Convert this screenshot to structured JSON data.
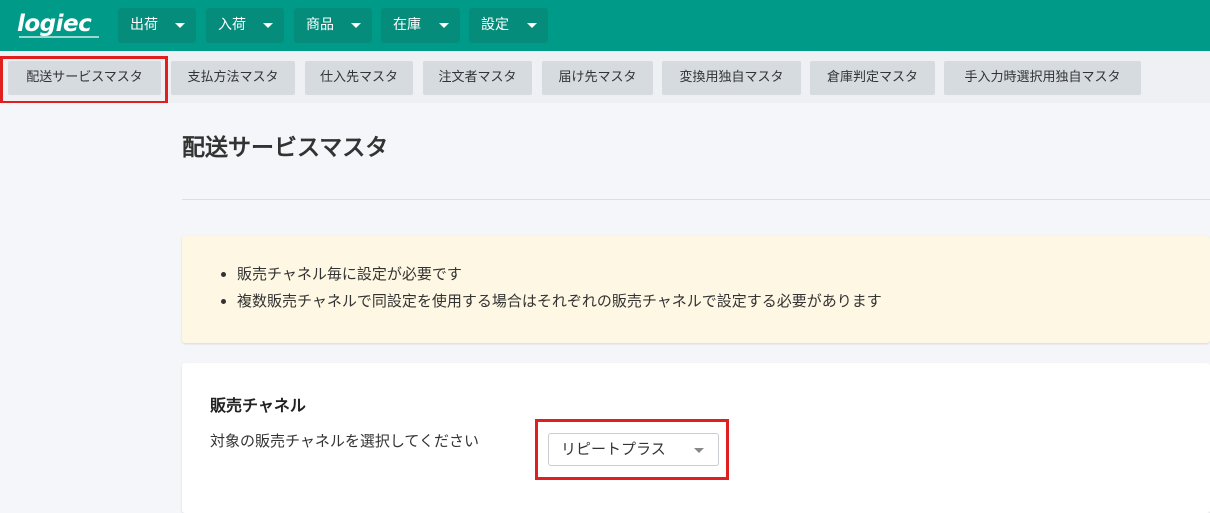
{
  "app": {
    "logo_text": "logiec",
    "brand_color": "#009b88",
    "highlight_color": "#e0201f"
  },
  "top_menu": [
    {
      "label": "出荷"
    },
    {
      "label": "入荷"
    },
    {
      "label": "商品"
    },
    {
      "label": "在庫"
    },
    {
      "label": "設定"
    }
  ],
  "sub_tabs": [
    {
      "label": "配送サービスマスタ",
      "active": true
    },
    {
      "label": "支払方法マスタ"
    },
    {
      "label": "仕入先マスタ"
    },
    {
      "label": "注文者マスタ"
    },
    {
      "label": "届け先マスタ"
    },
    {
      "label": "変換用独自マスタ"
    },
    {
      "label": "倉庫判定マスタ"
    },
    {
      "label": "手入力時選択用独自マスタ"
    }
  ],
  "page": {
    "title": "配送サービスマスタ"
  },
  "notice": {
    "items": [
      "販売チャネル毎に設定が必要です",
      "複数販売チャネルで同設定を使用する場合はそれぞれの販売チャネルで設定する必要があります"
    ]
  },
  "channel_card": {
    "title": "販売チャネル",
    "description": "対象の販売チャネルを選択してください",
    "selected_channel": "リピートプラス"
  }
}
